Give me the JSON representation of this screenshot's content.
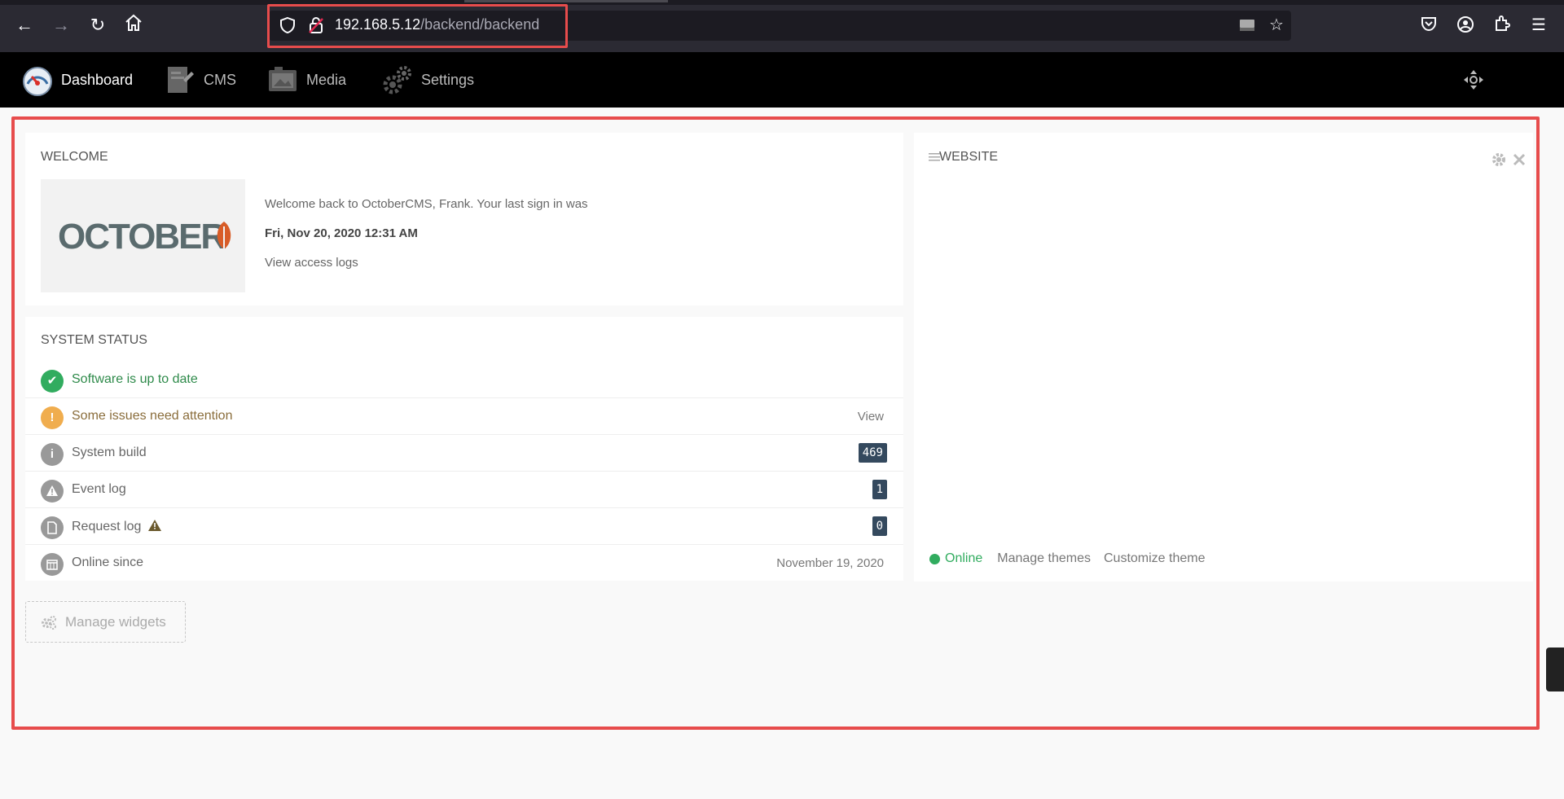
{
  "browser": {
    "url_host": "192.168.5.12",
    "url_path": "/backend/backend"
  },
  "nav": {
    "items": [
      {
        "label": "Dashboard",
        "icon": "dashboard-gauge-icon"
      },
      {
        "label": "CMS",
        "icon": "cms-icon"
      },
      {
        "label": "Media",
        "icon": "media-icon"
      },
      {
        "label": "Settings",
        "icon": "settings-gears-icon"
      }
    ]
  },
  "welcome": {
    "title": "WELCOME",
    "logo_text": "OCTOBER",
    "message": "Welcome back to OctoberCMS, Frank. Your last sign in was",
    "last_signin": "Fri, Nov 20, 2020 12:31 AM",
    "access_logs_link": "View access logs"
  },
  "system_status": {
    "title": "SYSTEM STATUS",
    "rows": [
      {
        "label": "Software is up to date",
        "icon": "check-icon",
        "color": "#31ac5f",
        "label_color": "#2e8a4a"
      },
      {
        "label": "Some issues need attention",
        "icon": "exclamation-icon",
        "color": "#f0ad4e",
        "label_color": "#8a6d3b",
        "right": "View"
      },
      {
        "label": "System build",
        "icon": "info-icon",
        "color": "#999999",
        "badge": "469"
      },
      {
        "label": "Event log",
        "icon": "warning-icon",
        "color": "#999999",
        "badge": "1"
      },
      {
        "label": "Request log",
        "icon": "file-icon",
        "color": "#999999",
        "badge": "0"
      },
      {
        "label": "Online since",
        "icon": "calendar-icon",
        "color": "#999999",
        "right": "November 19, 2020"
      }
    ]
  },
  "website": {
    "title": "WEBSITE",
    "status": "Online",
    "manage_themes": "Manage themes",
    "customize_theme": "Customize theme"
  },
  "manage_widgets": {
    "label": "Manage widgets"
  },
  "colors": {
    "highlight": "#e74c4c",
    "badge_bg": "#34495e",
    "online": "#31ac5f"
  }
}
